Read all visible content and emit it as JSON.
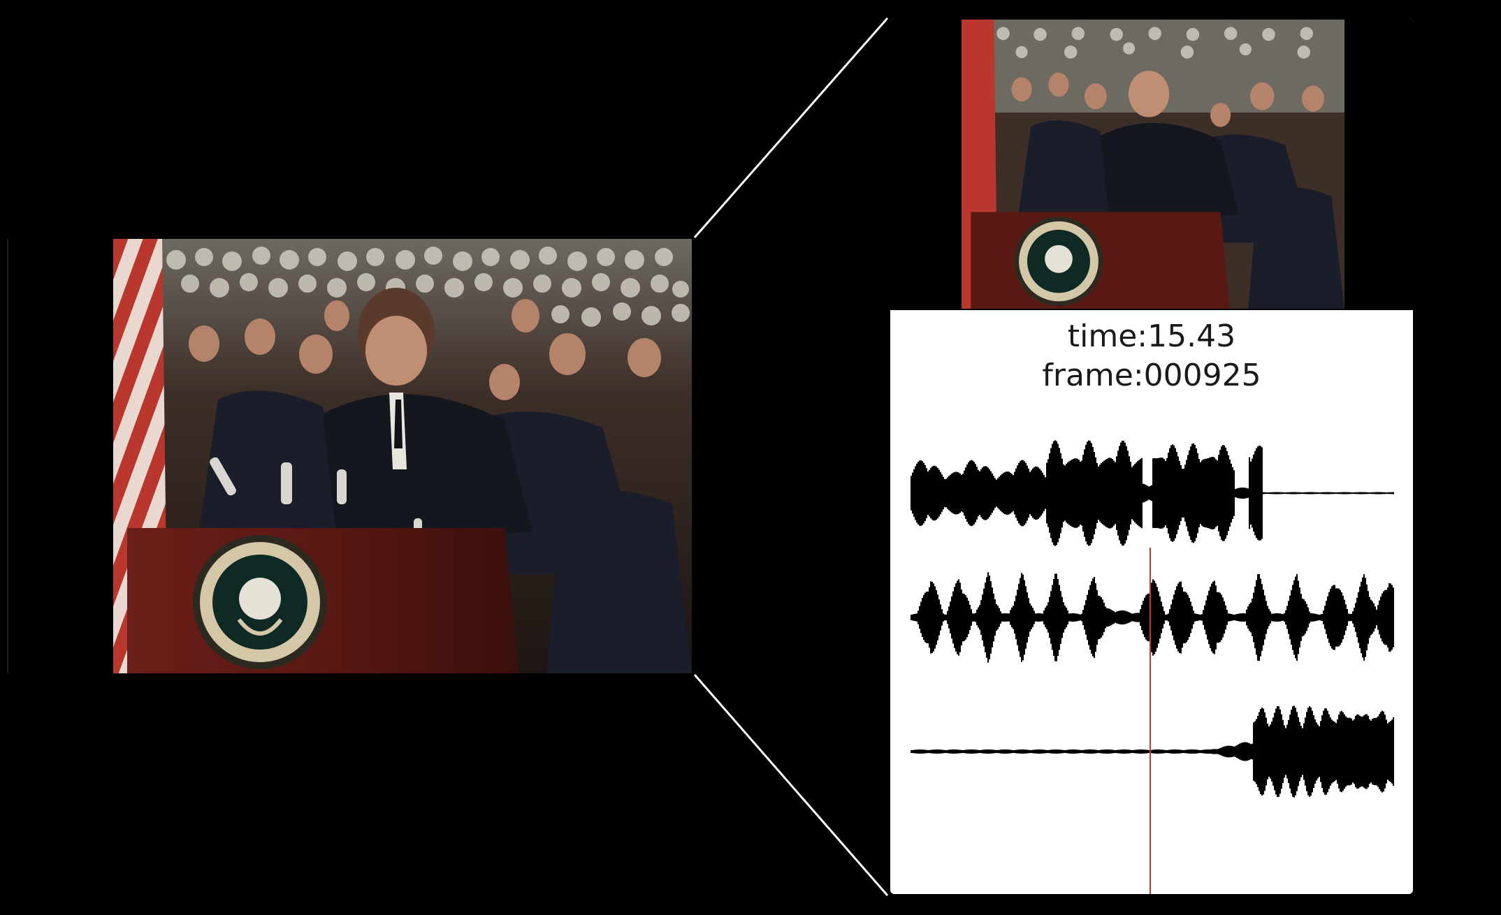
{
  "overlay": {
    "time_text": "time:15.43",
    "frame_text": "frame:000925"
  },
  "colors": {
    "background": "#000000",
    "panel": "#ffffff",
    "waveform": "#000000",
    "playhead": "#d9342b"
  },
  "waveform": {
    "tracks": 3,
    "playhead_fraction": 0.5
  }
}
